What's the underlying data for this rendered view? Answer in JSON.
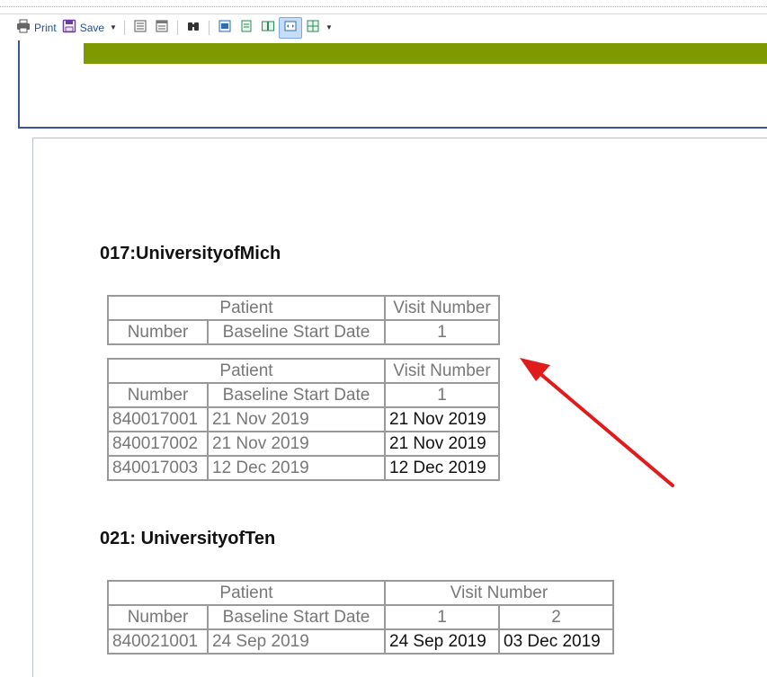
{
  "toolbar": {
    "print_label": "Print",
    "save_label": "Save"
  },
  "colors": {
    "accent_green": "#7f9a00",
    "frame_blue": "#3a5694",
    "arrow_red": "#e11b1b"
  },
  "sections": [
    {
      "title": "017:UniversityofMich",
      "header_table": {
        "group_patient": "Patient",
        "group_visit": "Visit Number",
        "col_number": "Number",
        "col_baseline": "Baseline Start Date",
        "visit_cols": [
          "1"
        ]
      },
      "data_table": {
        "group_patient": "Patient",
        "group_visit": "Visit Number",
        "col_number": "Number",
        "col_baseline": "Baseline Start Date",
        "visit_cols": [
          "1"
        ],
        "rows": [
          {
            "number": "840017001",
            "baseline": "21 Nov 2019",
            "visits": [
              "21 Nov 2019"
            ]
          },
          {
            "number": "840017002",
            "baseline": "21 Nov 2019",
            "visits": [
              "21 Nov 2019"
            ]
          },
          {
            "number": "840017003",
            "baseline": "12 Dec 2019",
            "visits": [
              "12 Dec 2019"
            ]
          }
        ]
      }
    },
    {
      "title": "021: UniversityofTen",
      "data_table": {
        "group_patient": "Patient",
        "group_visit": "Visit Number",
        "col_number": "Number",
        "col_baseline": "Baseline Start Date",
        "visit_cols": [
          "1",
          "2"
        ],
        "rows": [
          {
            "number": "840021001",
            "baseline": "24 Sep 2019",
            "visits": [
              "24 Sep 2019",
              "03 Dec 2019"
            ]
          }
        ]
      }
    }
  ]
}
